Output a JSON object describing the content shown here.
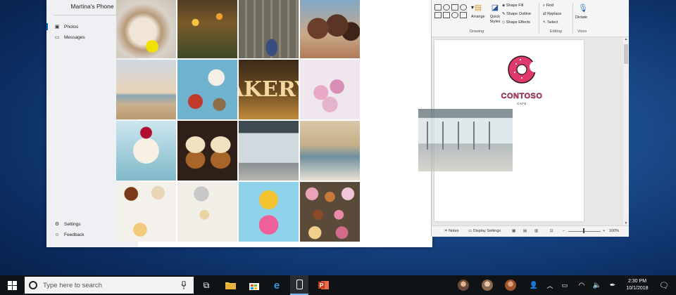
{
  "phone": {
    "device_name": "Martina's Phone",
    "nav": {
      "photos": "Photos",
      "messages": "Messages"
    },
    "bottom": {
      "settings": "Settings",
      "feedback": "Feedback"
    },
    "photos": [
      "pug puppy with yellow ball",
      "wildflowers",
      "feet on cobblestone",
      "smiling kids",
      "family at beach",
      "baking ingredients",
      "bakery sign",
      "pink macarons",
      "berry cheesecake",
      "caramel cupcakes",
      "cafe storefront",
      "cafe interior",
      "baking tools",
      "whisk and sieve",
      "two donuts",
      "assorted donuts"
    ]
  },
  "word": {
    "ribbon": {
      "arrange": "Arrange",
      "quick_styles": "Quick Styles",
      "shape_fill": "Shape Fill",
      "shape_outline": "Shape Outline",
      "shape_effects": "Shape Effects",
      "find": "Find",
      "replace": "Replace",
      "select": "Select",
      "dictate": "Dictate",
      "group_drawing": "Drawing",
      "group_editing": "Editing",
      "group_voice": "Voice"
    },
    "logo": {
      "name": "CONTOSO",
      "sub": "CAFE"
    },
    "status": {
      "notes": "Notes",
      "display": "Display Settings",
      "zoom": "100%"
    }
  },
  "taskbar": {
    "search_placeholder": "Type here to search",
    "time": "2:30 PM",
    "date": "10/1/2018"
  },
  "colors": {
    "accent": "#0067c0",
    "logo_pink": "#e03a6a",
    "taskbar": "#101316"
  }
}
